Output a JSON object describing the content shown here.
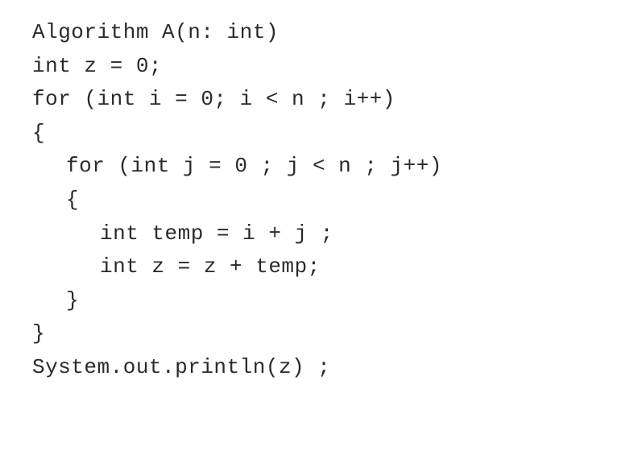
{
  "code": {
    "line1": "Algorithm A(n: int)",
    "line2": "int z = 0;",
    "line3": "for (int i = 0; i < n ; i++)",
    "line4": "{",
    "line5": "for (int j = 0 ; j < n ; j++)",
    "line6": "{",
    "line7": "int temp = i + j ;",
    "line8": "int z = z + temp;",
    "line9": "}",
    "line10": "}",
    "line11": "System.out.println(z) ;"
  }
}
